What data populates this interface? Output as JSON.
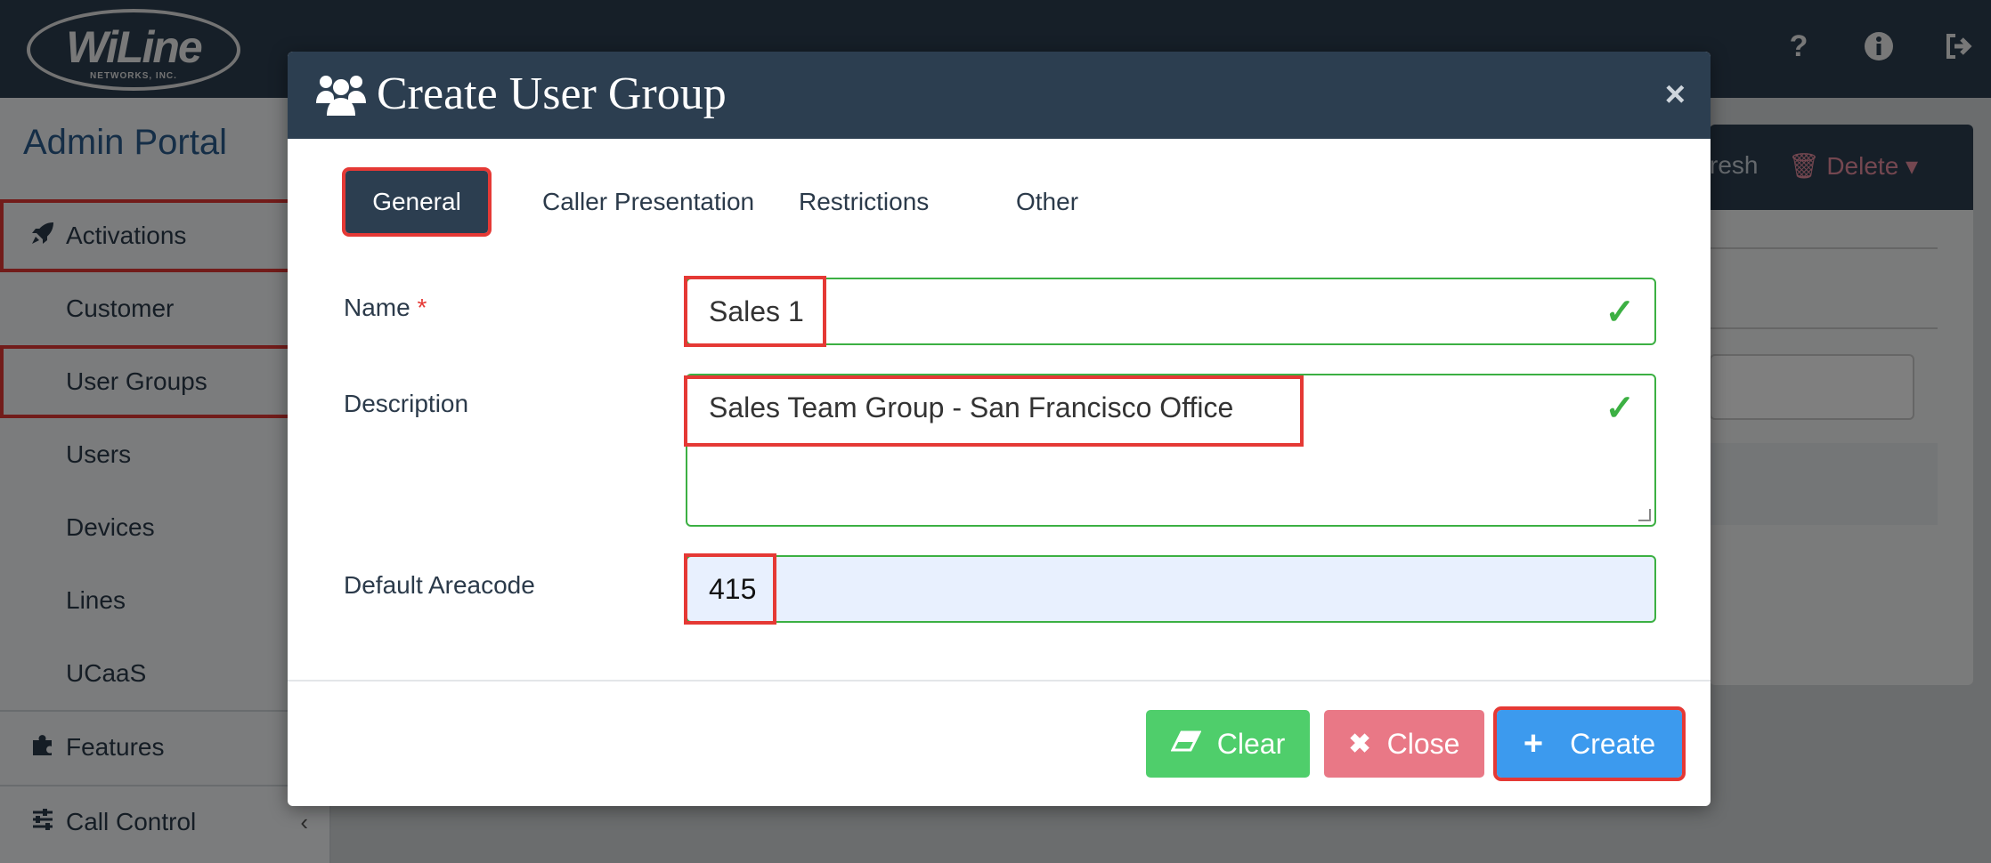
{
  "app": {
    "logo_text": "WiLine",
    "logo_subtext": "NETWORKS, INC.",
    "portal_title": "Admin Portal"
  },
  "topbar": {
    "icons": [
      "question-icon",
      "info-icon",
      "sign-out-icon"
    ]
  },
  "sidebar": {
    "items": [
      {
        "label": "Activations",
        "icon": "rocket-icon"
      },
      {
        "label": "Customer"
      },
      {
        "label": "User Groups"
      },
      {
        "label": "Users"
      },
      {
        "label": "Devices"
      },
      {
        "label": "Lines"
      },
      {
        "label": "UCaaS"
      },
      {
        "label": "Features",
        "icon": "puzzle-icon"
      },
      {
        "label": "Call Control",
        "icon": "sliders-icon"
      }
    ]
  },
  "background_panel": {
    "refresh_label": "resh",
    "delete_label": "Delete"
  },
  "modal": {
    "title": "Create User Group",
    "close_glyph": "×",
    "tabs": [
      "General",
      "Caller Presentation",
      "Restrictions",
      "Other"
    ],
    "active_tab": "General",
    "fields": {
      "name": {
        "label": "Name",
        "required_mark": "*",
        "value": "Sales 1"
      },
      "description": {
        "label": "Description",
        "value": "Sales Team Group - San Francisco Office"
      },
      "areacode": {
        "label": "Default Areacode",
        "value": "415"
      }
    },
    "buttons": {
      "clear": "Clear",
      "close": "Close",
      "create": "Create"
    }
  },
  "colors": {
    "header_bg": "#2c3e50",
    "valid_green": "#3cb043",
    "highlight_red": "#e53935",
    "clear_button": "#4fce6b",
    "close_button": "#e97886",
    "create_button": "#3c9aee"
  }
}
